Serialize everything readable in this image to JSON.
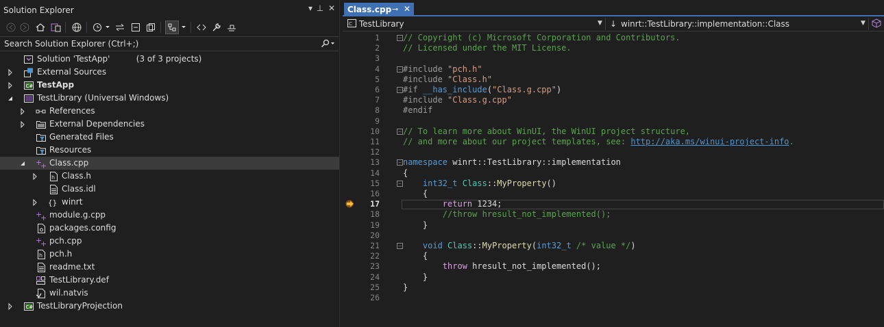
{
  "solution_explorer": {
    "title": "Solution Explorer",
    "title_controls": [
      "▾",
      "⊥",
      "✕"
    ],
    "search_placeholder": "Search Solution Explorer (Ctrl+;)",
    "tree": [
      {
        "label": "Solution 'TestApp'",
        "extra": "(3 of 3 projects)",
        "icon": "solution-icon",
        "indent": 0,
        "arrow": "none",
        "bold": false,
        "selected": false
      },
      {
        "label": "External Sources",
        "icon": "external-sources-icon",
        "indent": 0,
        "arrow": "collapsed",
        "bold": false,
        "selected": false
      },
      {
        "label": "TestApp",
        "icon": "csharp-project-icon",
        "indent": 0,
        "arrow": "collapsed",
        "bold": true,
        "selected": false
      },
      {
        "label": "TestLibrary (Universal Windows)",
        "icon": "cpp-project-icon",
        "indent": 0,
        "arrow": "expanded",
        "bold": false,
        "selected": false
      },
      {
        "label": "References",
        "icon": "references-icon",
        "indent": 1,
        "arrow": "collapsed",
        "bold": false,
        "selected": false
      },
      {
        "label": "External Dependencies",
        "icon": "folder-icon",
        "indent": 1,
        "arrow": "collapsed",
        "bold": false,
        "selected": false
      },
      {
        "label": "Generated Files",
        "icon": "filter-folder-icon",
        "indent": 1,
        "arrow": "none",
        "bold": false,
        "selected": false
      },
      {
        "label": "Resources",
        "icon": "filter-folder-icon",
        "indent": 1,
        "arrow": "none",
        "bold": false,
        "selected": false
      },
      {
        "label": "Class.cpp",
        "icon": "cpp-file-icon",
        "indent": 1,
        "arrow": "expanded",
        "bold": false,
        "selected": true
      },
      {
        "label": "Class.h",
        "icon": "header-file-icon",
        "indent": 2,
        "arrow": "collapsed",
        "bold": false,
        "selected": false
      },
      {
        "label": "Class.idl",
        "icon": "text-file-icon",
        "indent": 2,
        "arrow": "none",
        "bold": false,
        "selected": false
      },
      {
        "label": "winrt",
        "icon": "namespace-icon",
        "indent": 2,
        "arrow": "collapsed",
        "bold": false,
        "selected": false
      },
      {
        "label": "module.g.cpp",
        "icon": "cpp-file-icon",
        "indent": 1,
        "arrow": "none",
        "bold": false,
        "selected": false
      },
      {
        "label": "packages.config",
        "icon": "config-file-icon",
        "indent": 1,
        "arrow": "none",
        "bold": false,
        "selected": false
      },
      {
        "label": "pch.cpp",
        "icon": "cpp-file-icon",
        "indent": 1,
        "arrow": "none",
        "bold": false,
        "selected": false
      },
      {
        "label": "pch.h",
        "icon": "header-file-icon",
        "indent": 1,
        "arrow": "none",
        "bold": false,
        "selected": false
      },
      {
        "label": "readme.txt",
        "icon": "text-file-icon",
        "indent": 1,
        "arrow": "none",
        "bold": false,
        "selected": false
      },
      {
        "label": "TestLibrary.def",
        "icon": "def-file-icon",
        "indent": 1,
        "arrow": "none",
        "bold": false,
        "selected": false
      },
      {
        "label": "wil.natvis",
        "icon": "natvis-file-icon",
        "indent": 1,
        "arrow": "none",
        "bold": false,
        "selected": false
      },
      {
        "label": "TestLibraryProjection",
        "icon": "csharp-project-icon",
        "indent": 0,
        "arrow": "collapsed",
        "bold": false,
        "selected": false
      }
    ]
  },
  "editor": {
    "tab": {
      "label": "Class.cpp",
      "pin": "⊸",
      "close": "✕"
    },
    "nav": {
      "project": "TestLibrary",
      "scope": "winrt::TestLibrary::implementation::Class"
    },
    "current_line": 17,
    "lines": [
      {
        "n": 1,
        "fold": "−",
        "html": [
          [
            "cm",
            "// Copyright (c) Microsoft Corporation and Contributors."
          ]
        ]
      },
      {
        "n": 2,
        "fold": "",
        "html": [
          [
            "cm",
            "// Licensed under the MIT License."
          ]
        ]
      },
      {
        "n": 3,
        "fold": "",
        "html": []
      },
      {
        "n": 4,
        "fold": "−",
        "html": [
          [
            "pp",
            "#include "
          ],
          [
            "str",
            "\"pch.h\""
          ]
        ]
      },
      {
        "n": 5,
        "fold": "",
        "html": [
          [
            "pp",
            "#include "
          ],
          [
            "str",
            "\"Class.h\""
          ]
        ]
      },
      {
        "n": 6,
        "fold": "−",
        "html": [
          [
            "pp",
            "#if "
          ],
          [
            "kw",
            "__has_include"
          ],
          [
            "",
            "("
          ],
          [
            "str",
            "\"Class.g.cpp\""
          ],
          [
            "",
            ")"
          ]
        ]
      },
      {
        "n": 7,
        "fold": "",
        "html": [
          [
            "pp",
            "#include "
          ],
          [
            "str",
            "\"Class.g.cpp\""
          ]
        ]
      },
      {
        "n": 8,
        "fold": "",
        "html": [
          [
            "pp",
            "#endif"
          ]
        ]
      },
      {
        "n": 9,
        "fold": "",
        "html": []
      },
      {
        "n": 10,
        "fold": "−",
        "html": [
          [
            "cm",
            "// To learn more about WinUI, the WinUI project structure,"
          ]
        ]
      },
      {
        "n": 11,
        "fold": "",
        "html": [
          [
            "cm",
            "// and more about our project templates, see: "
          ],
          [
            "lnk",
            "http://aka.ms/winui-project-info"
          ],
          [
            "cm",
            "."
          ]
        ]
      },
      {
        "n": 12,
        "fold": "",
        "html": []
      },
      {
        "n": 13,
        "fold": "−",
        "html": [
          [
            "kw",
            "namespace"
          ],
          [
            "",
            " winrt::TestLibrary::implementation"
          ]
        ]
      },
      {
        "n": 14,
        "fold": "",
        "html": [
          [
            "",
            "{"
          ]
        ]
      },
      {
        "n": 15,
        "fold": "−",
        "html": [
          [
            "",
            "    "
          ],
          [
            "kw",
            "int32_t"
          ],
          [
            "",
            " "
          ],
          [
            "ty",
            "Class"
          ],
          [
            "",
            "::"
          ],
          [
            "fn",
            "MyProperty"
          ],
          [
            "",
            "()"
          ]
        ]
      },
      {
        "n": 16,
        "fold": "",
        "html": [
          [
            "",
            "    {"
          ]
        ]
      },
      {
        "n": 17,
        "fold": "",
        "html": [
          [
            "",
            "        "
          ],
          [
            "ctl",
            "return"
          ],
          [
            "",
            " 1234;"
          ]
        ]
      },
      {
        "n": 18,
        "fold": "",
        "html": [
          [
            "",
            "        "
          ],
          [
            "cm",
            "//throw hresult_not_implemented();"
          ]
        ]
      },
      {
        "n": 19,
        "fold": "",
        "html": [
          [
            "",
            "    }"
          ]
        ]
      },
      {
        "n": 20,
        "fold": "",
        "html": []
      },
      {
        "n": 21,
        "fold": "−",
        "html": [
          [
            "",
            "    "
          ],
          [
            "kw",
            "void"
          ],
          [
            "",
            " "
          ],
          [
            "ty",
            "Class"
          ],
          [
            "",
            "::"
          ],
          [
            "fn",
            "MyProperty"
          ],
          [
            "",
            "("
          ],
          [
            "kw",
            "int32_t"
          ],
          [
            "",
            " "
          ],
          [
            "cm",
            "/* value */"
          ],
          [
            "",
            ")"
          ]
        ]
      },
      {
        "n": 22,
        "fold": "",
        "html": [
          [
            "",
            "    {"
          ]
        ]
      },
      {
        "n": 23,
        "fold": "",
        "html": [
          [
            "",
            "        "
          ],
          [
            "ctl",
            "throw"
          ],
          [
            "",
            " hresult_not_implemented();"
          ]
        ]
      },
      {
        "n": 24,
        "fold": "",
        "html": [
          [
            "",
            "    }"
          ]
        ]
      },
      {
        "n": 25,
        "fold": "",
        "html": [
          [
            "",
            "}"
          ]
        ]
      },
      {
        "n": 26,
        "fold": "",
        "html": []
      }
    ]
  },
  "colors": {
    "accent": "#3f70b3",
    "selection": "#3b3b3b",
    "comment": "#57a64a",
    "keyword": "#569cd6",
    "string": "#d69d85"
  }
}
